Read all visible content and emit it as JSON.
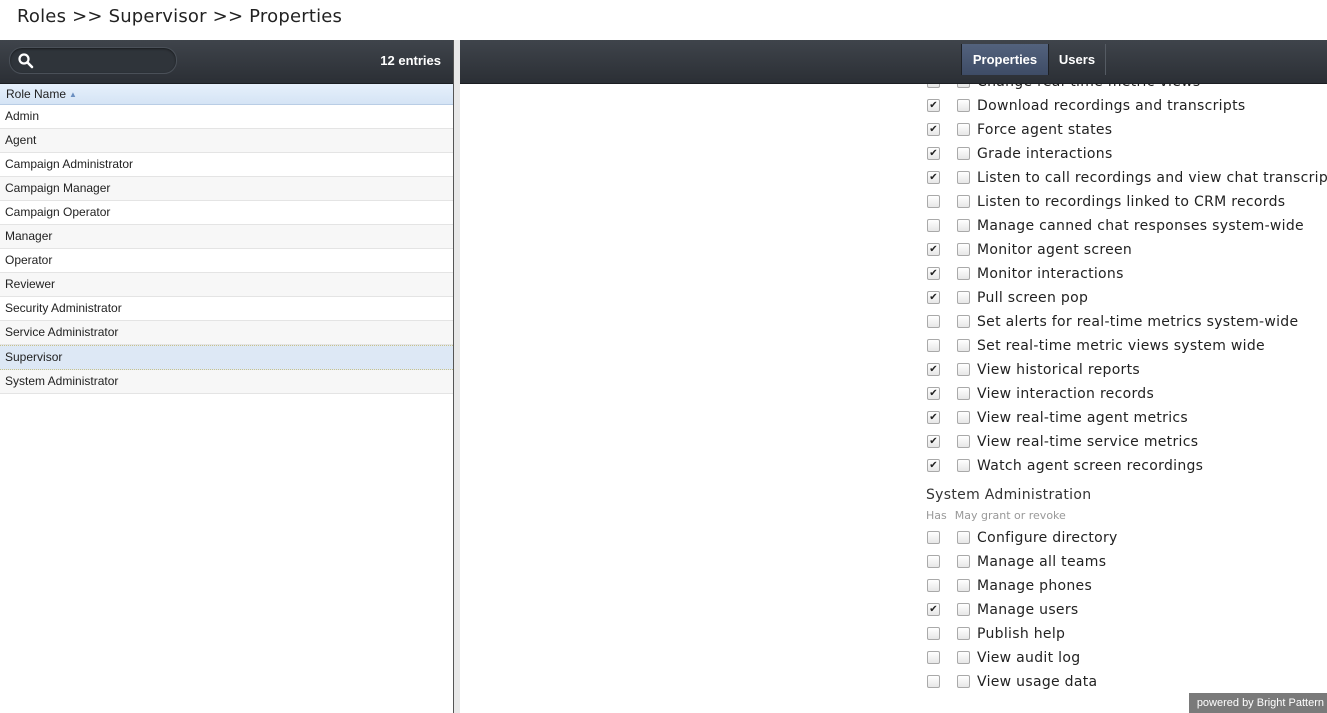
{
  "breadcrumb": "Roles >> Supervisor >> Properties",
  "left": {
    "search_placeholder": "",
    "entries_count": "12 entries",
    "column_header": "Role Name",
    "roles": [
      {
        "name": "Admin",
        "selected": false
      },
      {
        "name": "Agent",
        "selected": false
      },
      {
        "name": "Campaign Administrator",
        "selected": false
      },
      {
        "name": "Campaign Manager",
        "selected": false
      },
      {
        "name": "Campaign Operator",
        "selected": false
      },
      {
        "name": "Manager",
        "selected": false
      },
      {
        "name": "Operator",
        "selected": false
      },
      {
        "name": "Reviewer",
        "selected": false
      },
      {
        "name": "Security Administrator",
        "selected": false
      },
      {
        "name": "Service Administrator",
        "selected": false
      },
      {
        "name": "Supervisor",
        "selected": true
      },
      {
        "name": "System Administrator",
        "selected": false
      }
    ]
  },
  "tabs": [
    {
      "label": "Properties",
      "active": true
    },
    {
      "label": "Users",
      "active": false
    }
  ],
  "permissions_top": [
    {
      "label": "Change real-time metric views",
      "has": false,
      "grant": false
    },
    {
      "label": "Download recordings and transcripts",
      "has": true,
      "grant": false
    },
    {
      "label": "Force agent states",
      "has": true,
      "grant": false
    },
    {
      "label": "Grade interactions",
      "has": true,
      "grant": false
    },
    {
      "label": "Listen to call recordings and view chat transcripts",
      "has": true,
      "grant": false
    },
    {
      "label": "Listen to recordings linked to CRM records",
      "has": false,
      "grant": false
    },
    {
      "label": "Manage canned chat responses system-wide",
      "has": false,
      "grant": false
    },
    {
      "label": "Monitor agent screen",
      "has": true,
      "grant": false
    },
    {
      "label": "Monitor interactions",
      "has": true,
      "grant": false
    },
    {
      "label": "Pull screen pop",
      "has": true,
      "grant": false
    },
    {
      "label": "Set alerts for real-time metrics system-wide",
      "has": false,
      "grant": false
    },
    {
      "label": "Set real-time metric views system wide",
      "has": false,
      "grant": false
    },
    {
      "label": "View historical reports",
      "has": true,
      "grant": false
    },
    {
      "label": "View interaction records",
      "has": true,
      "grant": false
    },
    {
      "label": "View real-time agent metrics",
      "has": true,
      "grant": false
    },
    {
      "label": "View real-time service metrics",
      "has": true,
      "grant": false
    },
    {
      "label": "Watch agent screen recordings",
      "has": true,
      "grant": false
    }
  ],
  "system_admin": {
    "title": "System Administration",
    "col_has": "Has",
    "col_grant": "May grant or revoke",
    "items": [
      {
        "label": "Configure directory",
        "has": false,
        "grant": false
      },
      {
        "label": "Manage all teams",
        "has": false,
        "grant": false
      },
      {
        "label": "Manage phones",
        "has": false,
        "grant": false
      },
      {
        "label": "Manage users",
        "has": true,
        "grant": false
      },
      {
        "label": "Publish help",
        "has": false,
        "grant": false
      },
      {
        "label": "View audit log",
        "has": false,
        "grant": false
      },
      {
        "label": "View usage data",
        "has": false,
        "grant": false
      }
    ]
  },
  "footer": "powered by Bright Pattern"
}
